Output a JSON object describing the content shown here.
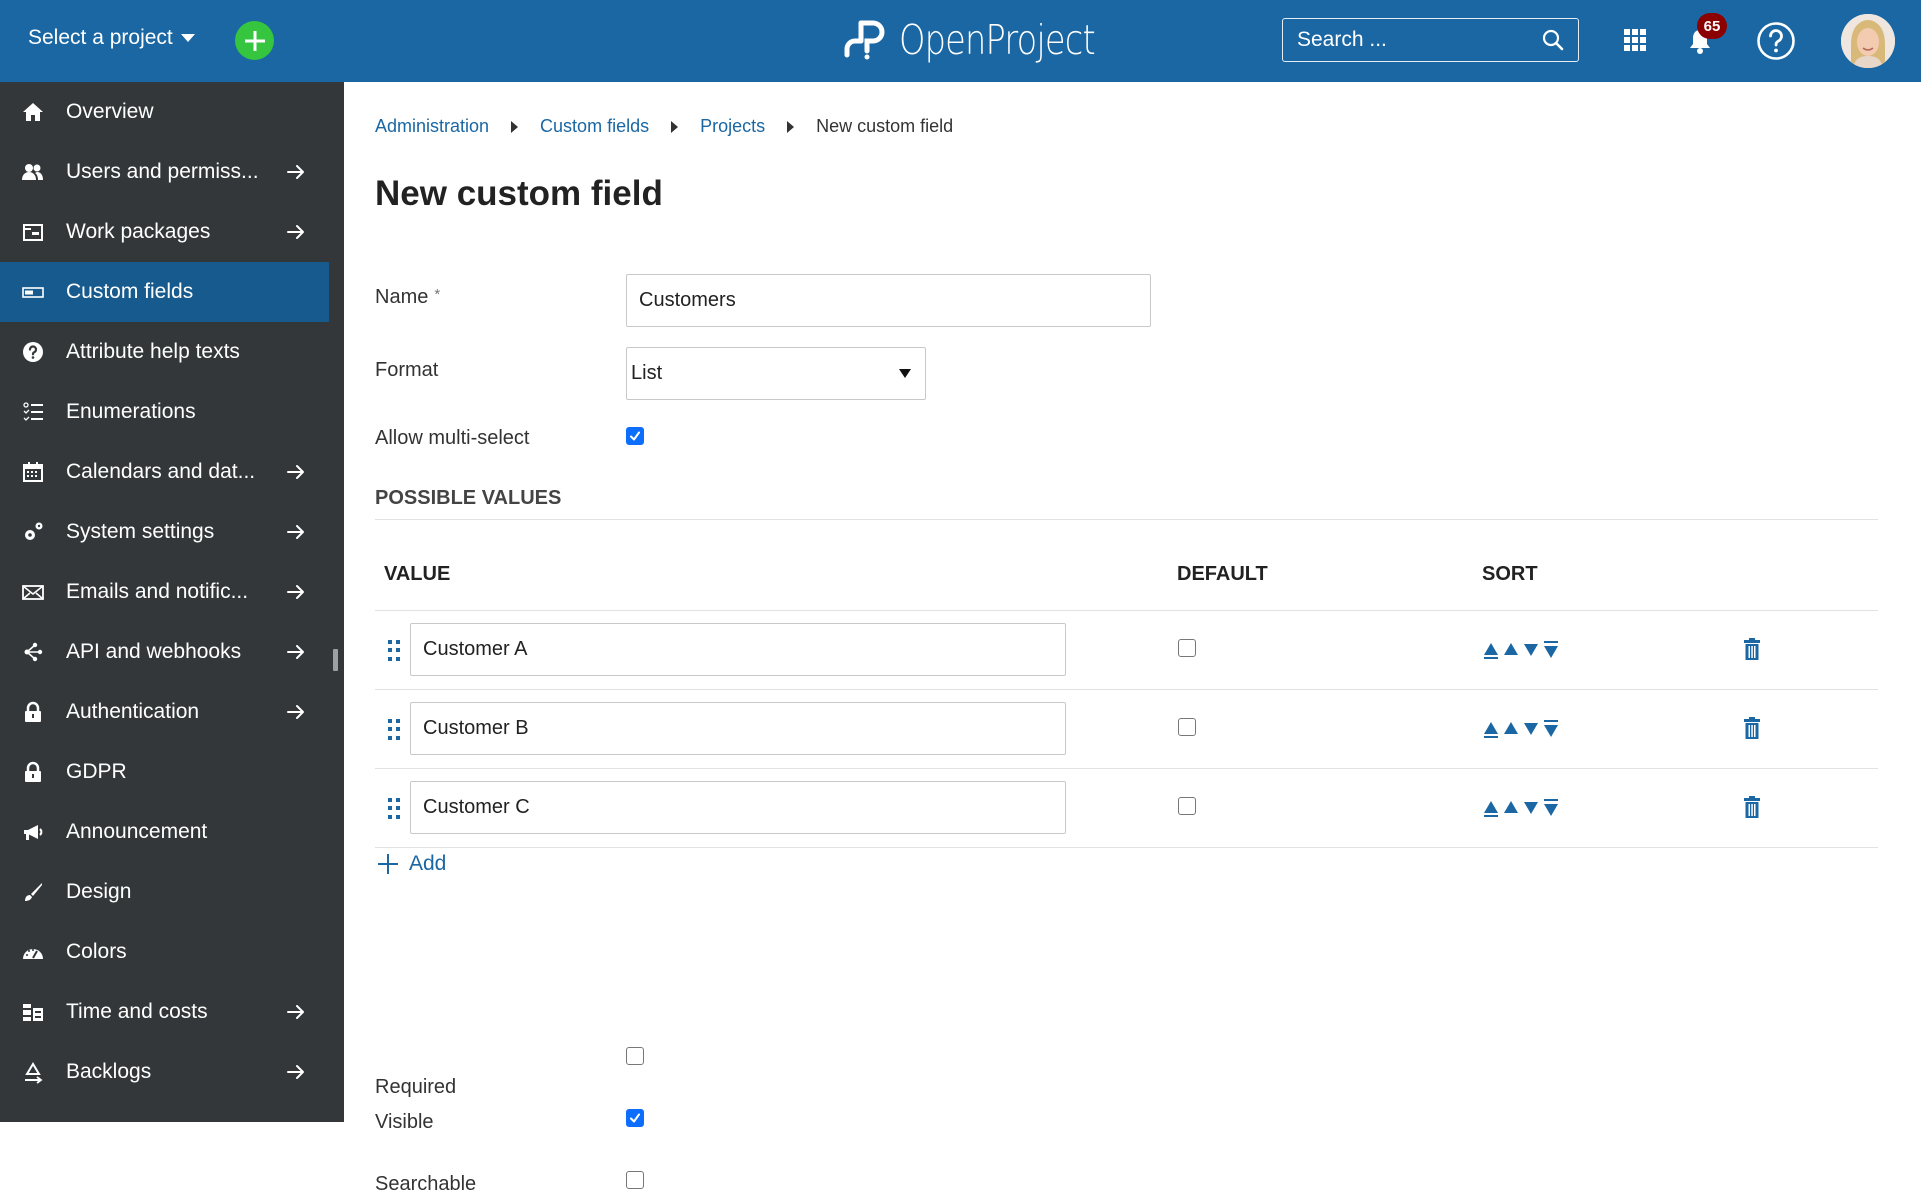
{
  "header": {
    "project_select": "Select a project",
    "logo_text": "OpenProject",
    "search_placeholder": "Search ...",
    "notification_count": "65",
    "colors": {
      "header_bg": "#1a67a3",
      "add_button": "#35c53f",
      "badge": "#8b0000"
    }
  },
  "sidebar": {
    "items": [
      {
        "label": "Overview",
        "icon": "home-icon",
        "arrow": false,
        "active": false
      },
      {
        "label": "Users and permiss...",
        "icon": "users-icon",
        "arrow": true,
        "active": false
      },
      {
        "label": "Work packages",
        "icon": "work-packages-icon",
        "arrow": true,
        "active": false
      },
      {
        "label": "Custom fields",
        "icon": "custom-fields-icon",
        "arrow": false,
        "active": true
      },
      {
        "label": "Attribute help texts",
        "icon": "help-icon",
        "arrow": false,
        "active": false
      },
      {
        "label": "Enumerations",
        "icon": "enumerations-icon",
        "arrow": false,
        "active": false
      },
      {
        "label": "Calendars and dat...",
        "icon": "calendar-icon",
        "arrow": true,
        "active": false
      },
      {
        "label": "System settings",
        "icon": "settings-icon",
        "arrow": true,
        "active": false
      },
      {
        "label": "Emails and notific...",
        "icon": "mail-icon",
        "arrow": true,
        "active": false
      },
      {
        "label": "API and webhooks",
        "icon": "api-icon",
        "arrow": true,
        "active": false
      },
      {
        "label": "Authentication",
        "icon": "lock-icon",
        "arrow": true,
        "active": false
      },
      {
        "label": "GDPR",
        "icon": "lock-icon",
        "arrow": false,
        "active": false
      },
      {
        "label": "Announcement",
        "icon": "megaphone-icon",
        "arrow": false,
        "active": false
      },
      {
        "label": "Design",
        "icon": "brush-icon",
        "arrow": false,
        "active": false
      },
      {
        "label": "Colors",
        "icon": "gauge-icon",
        "arrow": false,
        "active": false
      },
      {
        "label": "Time and costs",
        "icon": "time-costs-icon",
        "arrow": true,
        "active": false
      },
      {
        "label": "Backlogs",
        "icon": "backlogs-icon",
        "arrow": true,
        "active": false
      }
    ]
  },
  "breadcrumb": {
    "items": [
      "Administration",
      "Custom fields",
      "Projects"
    ],
    "current": "New custom field"
  },
  "page": {
    "title": "New custom field"
  },
  "form": {
    "name_label": "Name",
    "name_required_mark": "*",
    "name_value": "Customers",
    "format_label": "Format",
    "format_value": "List",
    "multi_select_label": "Allow multi-select",
    "multi_select_checked": true,
    "possible_values_title": "POSSIBLE VALUES",
    "columns": {
      "value": "VALUE",
      "default": "DEFAULT",
      "sort": "SORT"
    },
    "values": [
      {
        "value": "Customer A",
        "default": false
      },
      {
        "value": "Customer B",
        "default": false
      },
      {
        "value": "Customer C",
        "default": false
      }
    ],
    "add_label": "Add",
    "required_label": "Required",
    "required_checked": false,
    "visible_label": "Visible",
    "visible_checked": true,
    "searchable_label": "Searchable",
    "searchable_checked": false
  }
}
